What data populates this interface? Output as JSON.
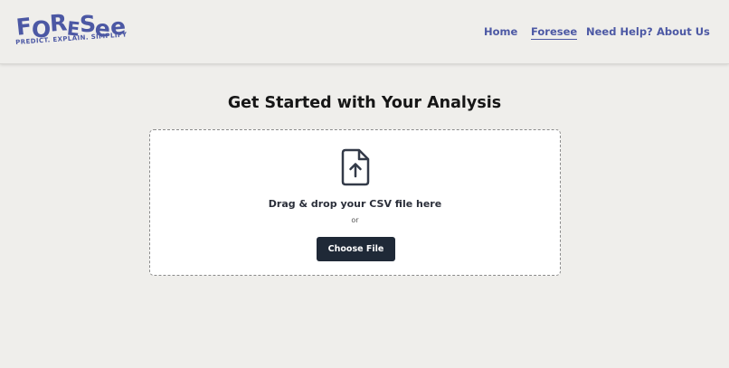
{
  "brand": {
    "logo_letters": [
      "F",
      "O",
      "R",
      "E",
      "S",
      "e",
      "e"
    ],
    "tagline": "PREDICT. EXPLAIN. SIMPLIFY",
    "color": "#4c58a4"
  },
  "nav": {
    "items": [
      {
        "label": "Home",
        "active": false
      },
      {
        "label": "Foresee",
        "active": true
      },
      {
        "label": "Need Help?",
        "active": false
      },
      {
        "label": "About Us",
        "active": false
      }
    ]
  },
  "main": {
    "title": "Get Started with Your Analysis",
    "upload": {
      "icon": "file-upload-icon",
      "drop_text": "Drag & drop your CSV file here",
      "or_text": "or",
      "button_label": "Choose File"
    }
  },
  "colors": {
    "background": "#efeeeb",
    "button": "#1f2937",
    "title_text": "#161616"
  }
}
